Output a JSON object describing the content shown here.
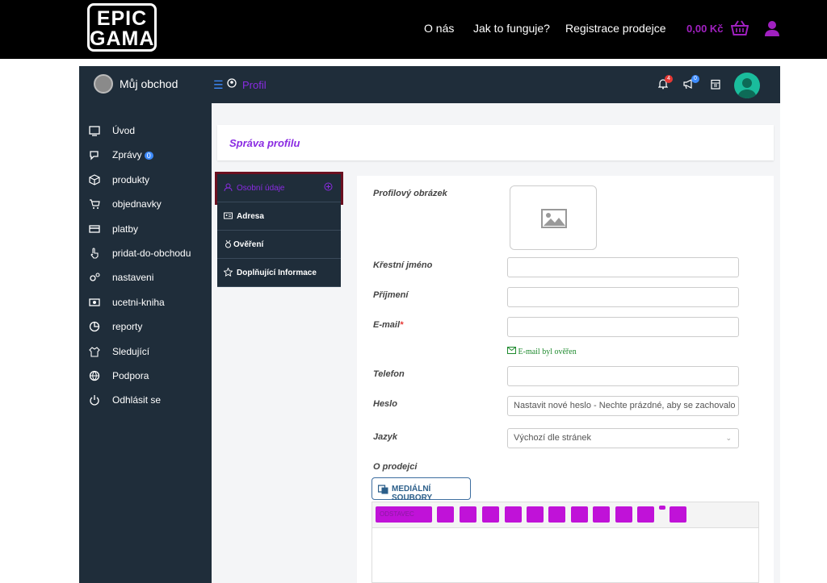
{
  "site": {
    "logo_line1": "EPIC",
    "logo_line2": "GAMA",
    "nav": [
      "O nás",
      "Jak to funguje?",
      "Registrace prodejce"
    ],
    "cart_total": "0,00 Kč",
    "accent": "#a020c0"
  },
  "app": {
    "shop_name": "Můj obchod",
    "breadcrumb": "Profil",
    "notif_count": "4",
    "announce_count": "0"
  },
  "sidebar": {
    "items": [
      {
        "label": "Úvod",
        "icon": "monitor-icon"
      },
      {
        "label": "Zprávy",
        "icon": "chat-icon",
        "badge": "0"
      },
      {
        "label": "produkty",
        "icon": "box-icon"
      },
      {
        "label": "objednavky",
        "icon": "cart-icon"
      },
      {
        "label": "platby",
        "icon": "card-icon"
      },
      {
        "label": "pridat-do-obchodu",
        "icon": "hand-pointer-icon"
      },
      {
        "label": "nastaveni",
        "icon": "gears-icon"
      },
      {
        "label": "ucetni-kniha",
        "icon": "money-icon"
      },
      {
        "label": "reporty",
        "icon": "pie-chart-icon"
      },
      {
        "label": "Sledující",
        "icon": "shirt-icon"
      },
      {
        "label": "Podpora",
        "icon": "globe-icon"
      },
      {
        "label": "Odhlásit se",
        "icon": "power-icon"
      }
    ]
  },
  "page": {
    "title": "Správa profilu",
    "tabs": [
      {
        "label": "Osobní údaje",
        "icon": "user-icon"
      },
      {
        "label": "Adresa",
        "icon": "id-card-icon"
      },
      {
        "label": "Ověření",
        "icon": "medal-icon"
      },
      {
        "label": "Doplňující Informace",
        "icon": "star-icon"
      }
    ]
  },
  "form": {
    "profile_image_label": "Profilový obrázek",
    "first_name_label": "Křestní jméno",
    "last_name_label": "Příjmení",
    "email_label": "E-mail",
    "email_required": "*",
    "email_verified": "E-mail byl ověřen",
    "phone_label": "Telefon",
    "password_label": "Heslo",
    "password_placeholder": "Nastavit nové heslo - Nechte prázdné, aby se zachovalo",
    "language_label": "Jazyk",
    "language_value": "Výchozí dle stránek",
    "about_label": "O prodejci",
    "media_button": "MEDIÁLNÍ SOUBORY",
    "editor_style_select": "ODSTAVEC"
  }
}
